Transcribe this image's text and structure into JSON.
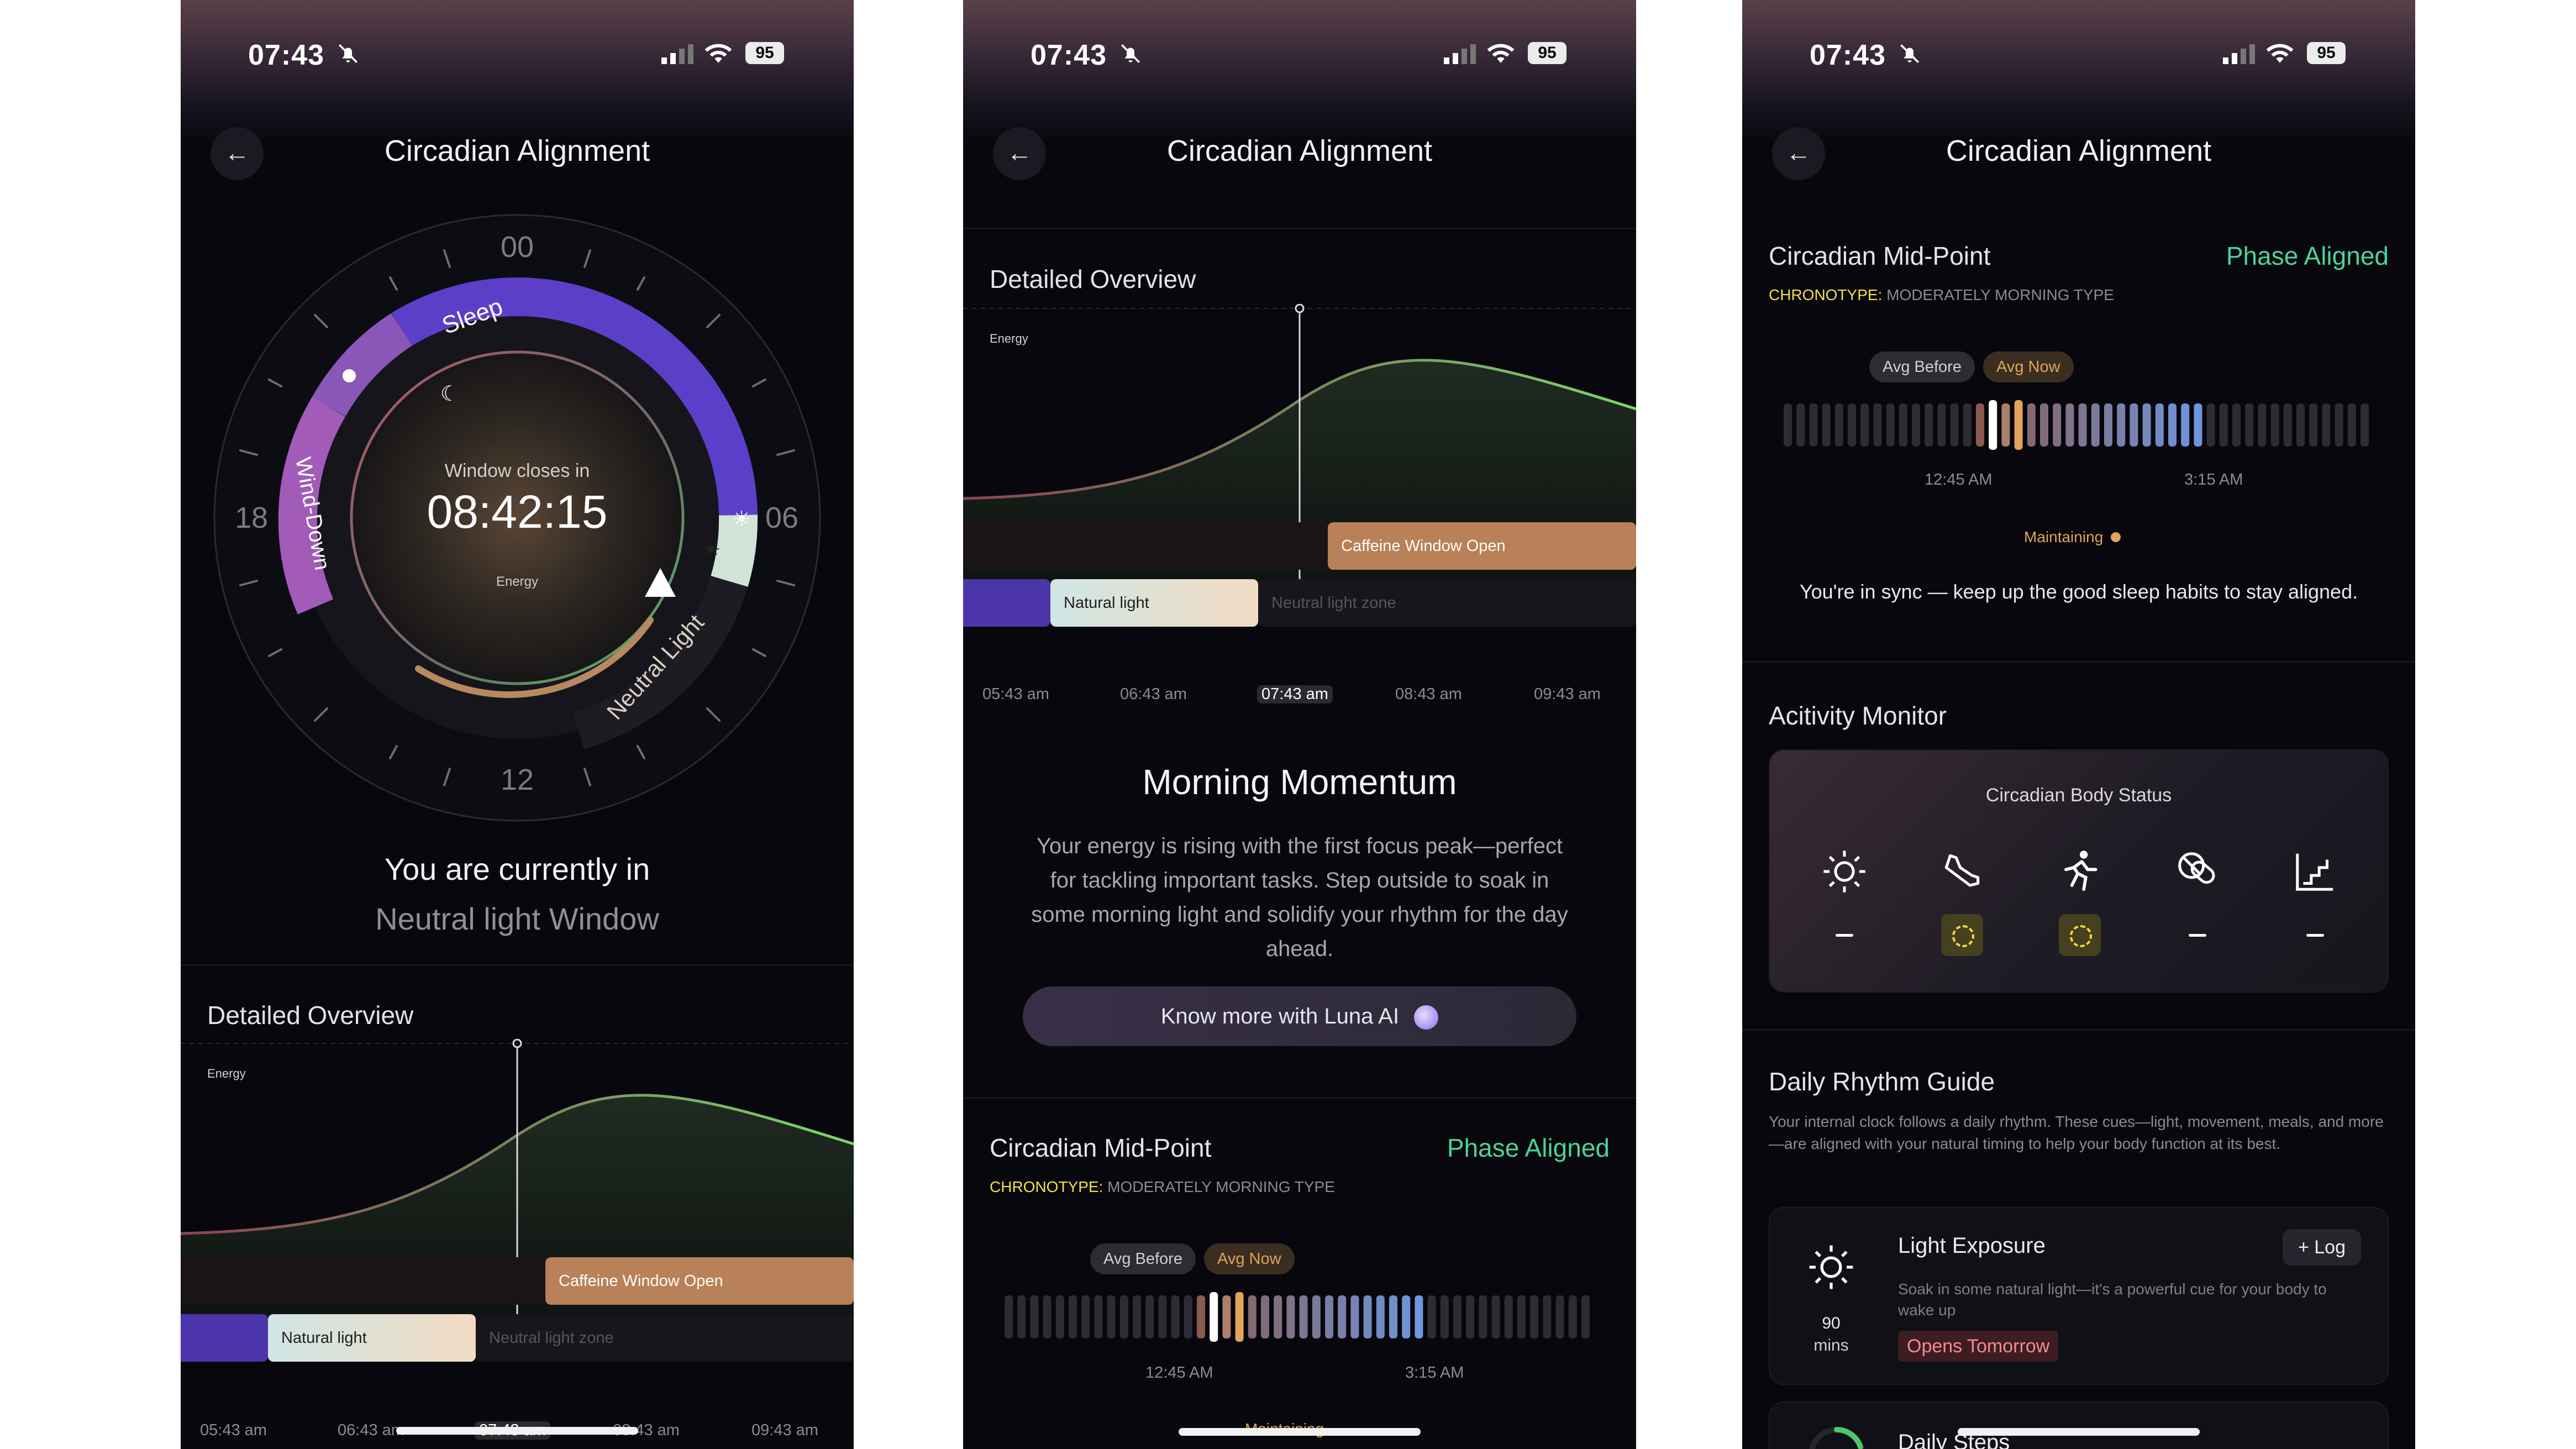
{
  "status_bar": {
    "time": "07:43",
    "battery": "95"
  },
  "header": {
    "title": "Circadian Alignment"
  },
  "dial": {
    "hour_labels": {
      "top": "00",
      "right": "06",
      "bottom": "12",
      "left": "18"
    },
    "segments": {
      "sleep": "Sleep",
      "wind_down": "Wind-Down",
      "neutral": "Neutral Light"
    },
    "window_closes_label": "Window closes in",
    "countdown": "08:42:15",
    "energy_label": "Energy"
  },
  "current_window": {
    "line1": "You are currently in",
    "line2": "Neutral light Window"
  },
  "overview": {
    "title": "Detailed Overview",
    "energy_label": "Energy",
    "caffeine_label": "Caffeine Window Open",
    "natural_light_label": "Natural light",
    "neutral_zone_label": "Neutral light zone",
    "ticks": [
      "05:43 am",
      "06:43 am",
      "07:43 am",
      "08:43 am",
      "09:43 am"
    ],
    "active_tick": "07:43 am"
  },
  "momentum": {
    "title": "Morning Momentum",
    "body": "Your energy is rising with the first focus peak—perfect for tackling important tasks. Step outside to soak in some morning light and solidify your rhythm for the day ahead.",
    "cta": "Know more with Luna AI"
  },
  "midpoint": {
    "title": "Circadian Mid-Point",
    "status": "Phase Aligned",
    "chronotype_key": "CHRONOTYPE:",
    "chronotype_value": "MODERATELY MORNING TYPE",
    "avg_before": "Avg Before",
    "avg_now": "Avg Now",
    "tick_left": "12:45 AM",
    "tick_right": "3:15 AM",
    "maintaining": "Maintaining",
    "sync_text": "You're in sync — keep up the good sleep habits to stay aligned."
  },
  "activity": {
    "title": "Acitivity Monitor",
    "card_title": "Circadian Body Status",
    "icons": [
      "sun-icon",
      "shoe-icon",
      "running-icon",
      "pill-icon",
      "stairs-icon"
    ],
    "states": [
      "dash",
      "pending",
      "pending",
      "dash",
      "dash"
    ]
  },
  "rhythm": {
    "title": "Daily Rhythm Guide",
    "body": "Your internal clock follows a daily rhythm. These cues—light, movement, meals, and more—are aligned with your natural timing to help your body function at its best.",
    "light": {
      "title": "Light Exposure",
      "log": "+ Log",
      "desc": "Soak in some natural light—it's a powerful cue for your body to wake up",
      "minutes": "90",
      "minutes_unit": "mins",
      "badge": "Opens Tomorrow"
    },
    "steps_title": "Daily Steps"
  },
  "colors": {
    "sleep": "#5b3fc8",
    "wind_down": "#a25bb8",
    "neutral": "#b88960",
    "aligned": "#49d49a",
    "chronotype": "#f1e14b",
    "avg_now": "#e2a35a",
    "energy_curve": "#7fd66b",
    "caffeine": "#b98157"
  }
}
